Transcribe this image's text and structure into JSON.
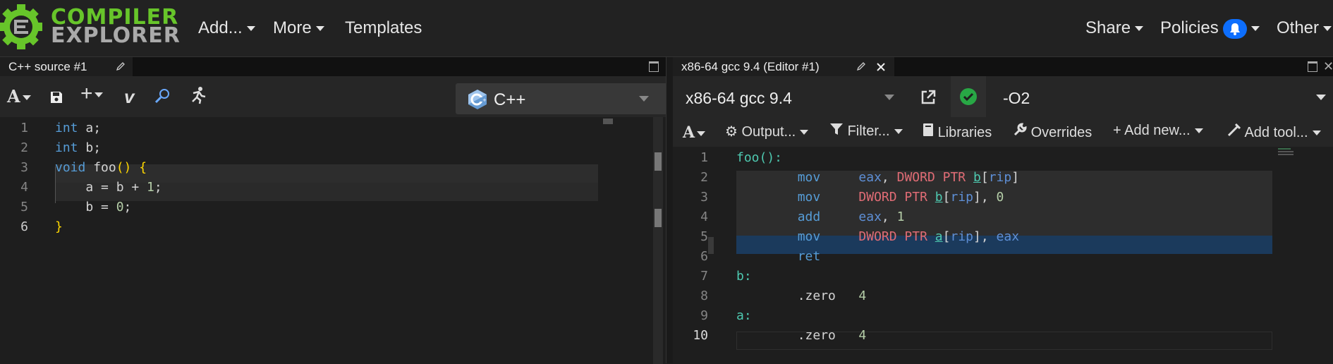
{
  "header": {
    "logo_line1": "COMPILER",
    "logo_line2": "EXPLORER",
    "nav_add": "Add...",
    "nav_more": "More",
    "nav_templates": "Templates",
    "nav_share": "Share",
    "nav_policies": "Policies",
    "nav_other": "Other"
  },
  "source_pane": {
    "tab_title": "C++ source #1",
    "language": "C++",
    "lines": [
      {
        "n": "1",
        "text": "int a;"
      },
      {
        "n": "2",
        "text": "int b;"
      },
      {
        "n": "3",
        "text": "void foo() {"
      },
      {
        "n": "4",
        "text": "    a = b + 1;"
      },
      {
        "n": "5",
        "text": "    b = 0;"
      },
      {
        "n": "6",
        "text": "}"
      }
    ]
  },
  "compiler_pane": {
    "tab_title": "x86-64 gcc 9.4 (Editor #1)",
    "compiler": "x86-64 gcc 9.4",
    "options": "-O2",
    "toolbar": {
      "output": "Output...",
      "filter": "Filter...",
      "libraries": "Libraries",
      "overrides": "Overrides",
      "add_new": "Add new...",
      "add_tool": "Add tool..."
    },
    "lines": [
      {
        "n": "1",
        "text": "foo():"
      },
      {
        "n": "2",
        "text": "        mov     eax, DWORD PTR b[rip]"
      },
      {
        "n": "3",
        "text": "        mov     DWORD PTR b[rip], 0"
      },
      {
        "n": "4",
        "text": "        add     eax, 1"
      },
      {
        "n": "5",
        "text": "        mov     DWORD PTR a[rip], eax"
      },
      {
        "n": "6",
        "text": "        ret"
      },
      {
        "n": "7",
        "text": "b:"
      },
      {
        "n": "8",
        "text": "        .zero   4"
      },
      {
        "n": "9",
        "text": "a:"
      },
      {
        "n": "10",
        "text": "        .zero   4"
      }
    ]
  },
  "colors": {
    "brand_green": "#67c52a",
    "accent_blue": "#0d6efd",
    "ok_green": "#28a745",
    "selected_line": "#1b3a5c"
  }
}
